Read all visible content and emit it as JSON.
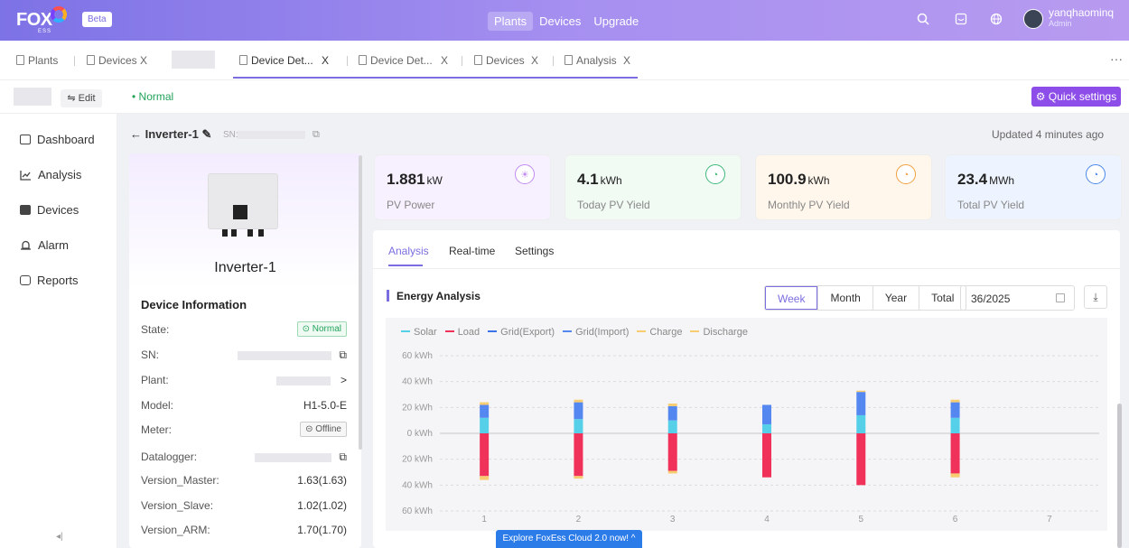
{
  "header": {
    "logo": "FOX",
    "logo_sub": "ESS",
    "beta": "Beta",
    "nav": [
      "Plants",
      "Devices",
      "Upgrade"
    ],
    "user_name": "yanqhaominq",
    "user_role": "Admin"
  },
  "tabs": [
    "Plants",
    "Devices",
    "Device Det...",
    "Device Det...",
    "Devices",
    "Analysis"
  ],
  "tab_close": "X",
  "more": "···",
  "subbar": {
    "edit": "⇋ Edit",
    "status": "• Normal",
    "quick_settings": "⚙ Quick settings"
  },
  "sidebar": [
    "Dashboard",
    "Analysis",
    "Devices",
    "Alarm",
    "Reports"
  ],
  "device": {
    "title": "← Inverter-1 ✎",
    "sn_label": "SN:",
    "updated": "Updated 4 minutes ago",
    "name": "Inverter-1",
    "info_title": "Device Information",
    "info": [
      {
        "k": "State:",
        "v": "⊙ Normal"
      },
      {
        "k": "SN:",
        "v": "⧉"
      },
      {
        "k": "Plant:",
        "v": ">"
      },
      {
        "k": "Model:",
        "v": "H1-5.0-E"
      },
      {
        "k": "Meter:",
        "v": "⊝ Offline"
      },
      {
        "k": "Datalogger:",
        "v": "⧉"
      },
      {
        "k": "Version_Master:",
        "v": "1.63(1.63)"
      },
      {
        "k": "Version_Slave:",
        "v": "1.02(1.02)"
      },
      {
        "k": "Version_ARM:",
        "v": "1.70(1.70)"
      }
    ]
  },
  "cards": [
    {
      "value": "1.881",
      "unit": "kW",
      "label": "PV Power",
      "icon": "sun-icon",
      "glyph": "☀",
      "bg": "#f7f1ff",
      "icon_color": "#c08af0"
    },
    {
      "value": "4.1",
      "unit": "kWh",
      "label": "Today PV Yield",
      "icon": "yield-icon",
      "glyph": "◔",
      "bg": "#f1fbf4",
      "icon_color": "#3cb878"
    },
    {
      "value": "100.9",
      "unit": "kWh",
      "label": "Monthly PV Yield",
      "icon": "yield-icon",
      "glyph": "◔",
      "bg": "#fff7ec",
      "icon_color": "#f0a040"
    },
    {
      "value": "23.4",
      "unit": "MWh",
      "label": "Total PV Yield",
      "icon": "yield-icon",
      "glyph": "◔",
      "bg": "#eef4ff",
      "icon_color": "#4a86e8"
    }
  ],
  "content_tabs": [
    "Analysis",
    "Real-time",
    "Settings"
  ],
  "energy": {
    "title": "Energy Analysis",
    "periods": [
      "Week",
      "Month",
      "Year",
      "Total"
    ],
    "selected_period": "Week",
    "date": "36/2025",
    "download_icon": "download-icon",
    "download_glyph": "⤓"
  },
  "explore": "Explore FoxEss Cloud 2.0 now!  ^",
  "collapse": "◂|",
  "chart_data": {
    "type": "bar",
    "stacked": true,
    "categories": [
      "1",
      "2",
      "3",
      "4",
      "5",
      "6",
      "7"
    ],
    "y_ticks": [
      "60 kWh",
      "40 kWh",
      "20 kWh",
      "0 kWh",
      "20 kWh",
      "40 kWh",
      "60 kWh"
    ],
    "ylim": [
      -60,
      60
    ],
    "legend": [
      "Solar",
      "Load",
      "Grid(Export)",
      "Grid(Import)",
      "Charge",
      "Discharge"
    ],
    "colors": {
      "Solar": "#56d0e8",
      "Load": "#f0325a",
      "Grid(Export)": "#3a74e8",
      "Grid(Import)": "#5488f0",
      "Charge": "#f8cc70",
      "Discharge": "#f8cc70"
    },
    "series": [
      {
        "name": "Solar",
        "values": [
          12,
          11,
          10,
          7,
          14,
          12,
          0
        ]
      },
      {
        "name": "Grid(Import)",
        "values": [
          10,
          13,
          11,
          15,
          18,
          12,
          0
        ]
      },
      {
        "name": "Charge",
        "values": [
          2,
          2,
          2,
          0,
          1,
          2,
          0
        ]
      },
      {
        "name": "Load",
        "values": [
          -33,
          -33,
          -29,
          -34,
          -40,
          -31,
          0
        ]
      },
      {
        "name": "Discharge",
        "values": [
          -3,
          -2,
          -2,
          0,
          0,
          -3,
          0
        ]
      }
    ],
    "grid": true
  }
}
